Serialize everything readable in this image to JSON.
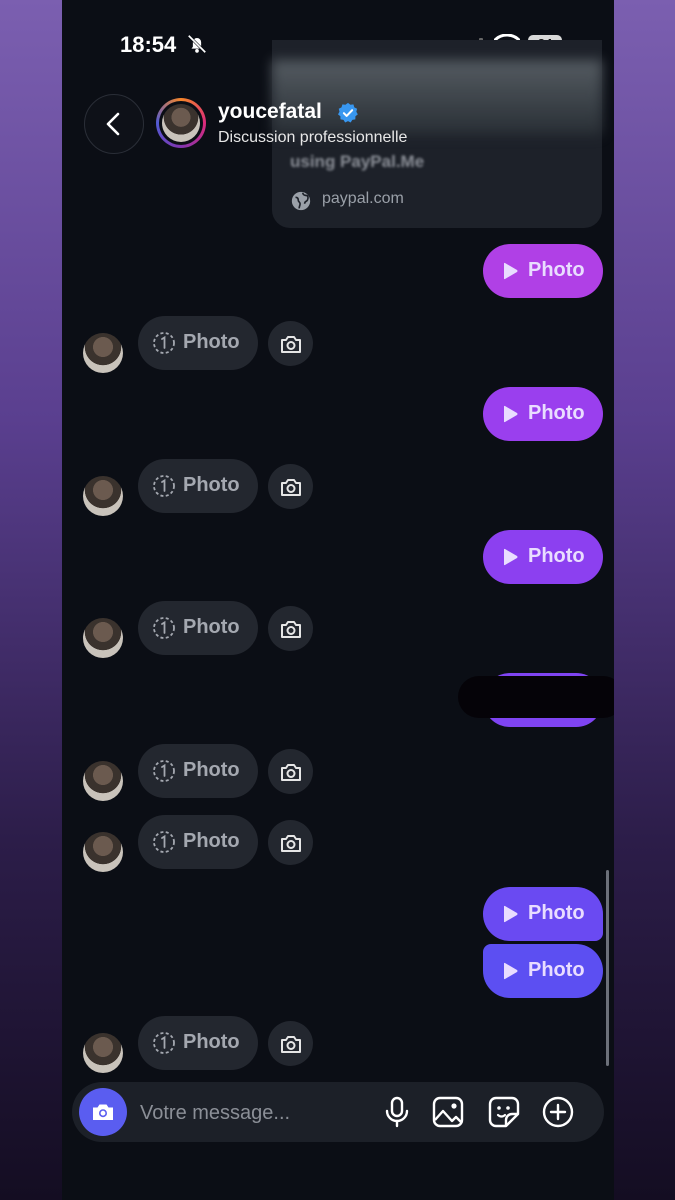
{
  "status_bar": {
    "time": "18:54",
    "battery": "34"
  },
  "link_preview": {
    "title": "using PayPal.Me",
    "domain": "paypal.com"
  },
  "header": {
    "name": "youcefatal",
    "subtitle": "Discussion professionnelle"
  },
  "messages": {
    "photo_label": "Photo"
  },
  "composer": {
    "placeholder": "Votre message..."
  },
  "colors": {
    "outgoing_top": "#b342e8",
    "outgoing_mid": "#8a3ff0",
    "outgoing_bottom": "#5f4df2",
    "incoming": "#23272f"
  },
  "icons": [
    "back-arrow-icon",
    "bell-muted-icon",
    "signal-icon",
    "wifi-icon",
    "globe-icon",
    "verified-icon",
    "play-icon",
    "view-once-icon",
    "camera-icon",
    "microphone-icon",
    "image-icon",
    "sticker-icon",
    "plus-icon"
  ]
}
